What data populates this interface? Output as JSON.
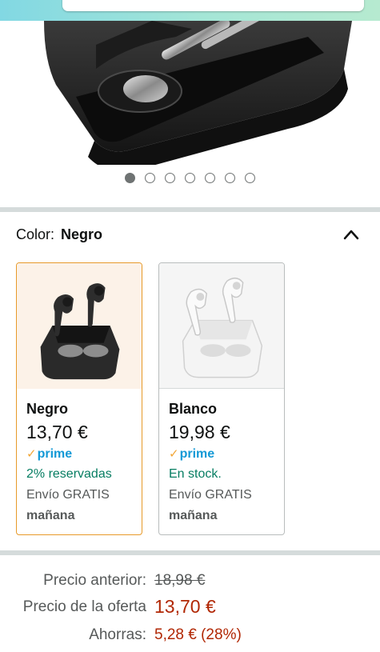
{
  "header": {
    "search_placeholder": ""
  },
  "gallery": {
    "image_icon": "black-earbuds-case-photo",
    "dot_count": 7,
    "active_dot": 0
  },
  "color_selector": {
    "label": "Color:",
    "selected_value": "Negro",
    "collapse_icon": "chevron-up-icon",
    "variants": [
      {
        "name": "Negro",
        "price": "13,70 €",
        "prime": "prime",
        "availability": "2% reservadas",
        "shipping": "Envío GRATIS",
        "delivery": "mañana",
        "selected": true
      },
      {
        "name": "Blanco",
        "price": "19,98 €",
        "prime": "prime",
        "availability": "En stock.",
        "shipping": "Envío GRATIS",
        "delivery": "mañana",
        "selected": false
      }
    ]
  },
  "pricing": {
    "previous_label": "Precio anterior:",
    "previous_value": "18,98 €",
    "deal_label": "Precio de la oferta",
    "deal_value": "13,70 €",
    "savings_label": "Ahorras:",
    "savings_value": "5,28 € (28%)"
  },
  "colors": {
    "accent_border": "#e79a2a",
    "price_red": "#b12704",
    "stock_green": "#067d62",
    "prime_blue": "#1399d6"
  }
}
